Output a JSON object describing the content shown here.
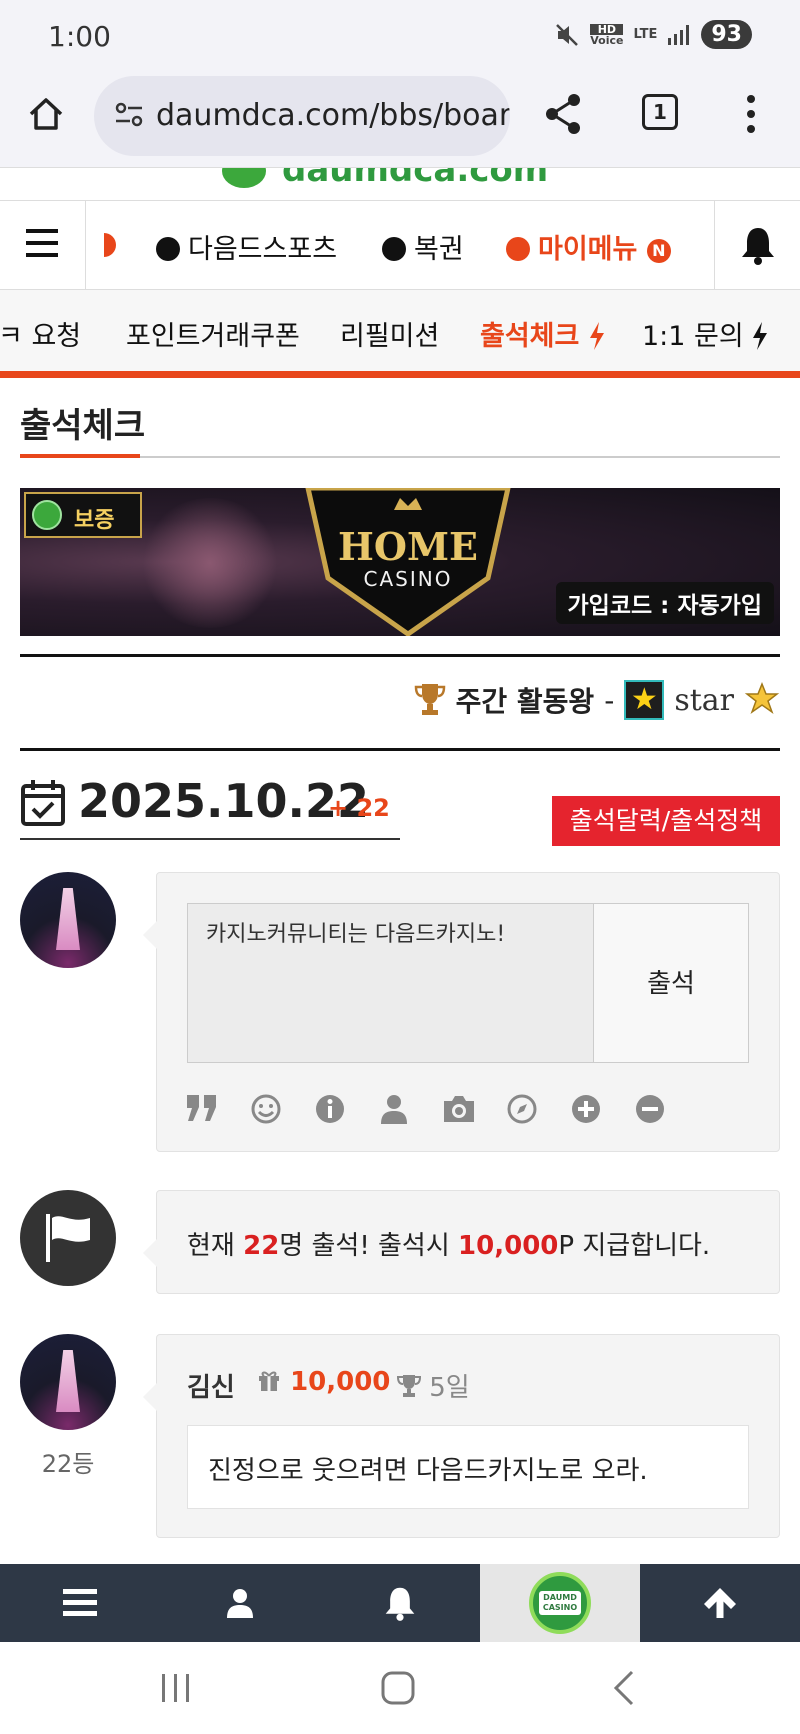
{
  "status": {
    "time": "1:00",
    "battery": "93",
    "hd_label": "HD",
    "voice_label": "Voice",
    "lte_label": "LTE"
  },
  "browser": {
    "url": "daumdca.com/bbs/board",
    "tab_count": "1"
  },
  "site_logo_partial": "daumdca.com",
  "nav_primary": [
    {
      "label": "다음드스포츠"
    },
    {
      "label": "복권"
    },
    {
      "label": "마이메뉴",
      "badge": "N"
    }
  ],
  "nav_secondary": [
    {
      "label": "요청",
      "prefix_partial": "ㅋ"
    },
    {
      "label": "포인트거래쿠폰"
    },
    {
      "label": "리필미션"
    },
    {
      "label": "출석체크"
    },
    {
      "label": "1:1 문의"
    }
  ],
  "page_title": "출석체크",
  "banner": {
    "badge": "보증",
    "brand_line1": "HOME",
    "brand_line2": "CASINO",
    "code_text": "가입코드 : 자동가입"
  },
  "weekly": {
    "label": "주간 활동왕",
    "separator": "-",
    "winner": "star"
  },
  "date": {
    "value": "2025.10.22",
    "count": "+ 22"
  },
  "calendar_button": "출석달력/출석정책",
  "compose": {
    "text": "카지노커뮤니티는 다음드카지노!",
    "submit": "출석"
  },
  "toolbar_icons": [
    "quote-icon",
    "emoji-icon",
    "info-icon",
    "user-icon",
    "camera-icon",
    "compass-icon",
    "plus-icon",
    "minus-icon"
  ],
  "info": {
    "prefix": "현재 ",
    "count": "22",
    "middle": "명 출석! 출석시 ",
    "points": "10,000",
    "suffix": "P 지급합니다."
  },
  "comment": {
    "name": "김신",
    "points": "10,000",
    "days": "5일",
    "body": "진정으로 웃으려면 다음드카지노로 오라.",
    "rank": "22등"
  },
  "bottom_nav": [
    "menu-icon",
    "user-icon",
    "bell-icon",
    "logo",
    "arrow-up-icon"
  ],
  "bottom_logo_text": "DAUMD CASINO",
  "colors": {
    "accent": "#e8461a",
    "red_button": "#e5242e",
    "bottom_nav": "#2e3846"
  }
}
